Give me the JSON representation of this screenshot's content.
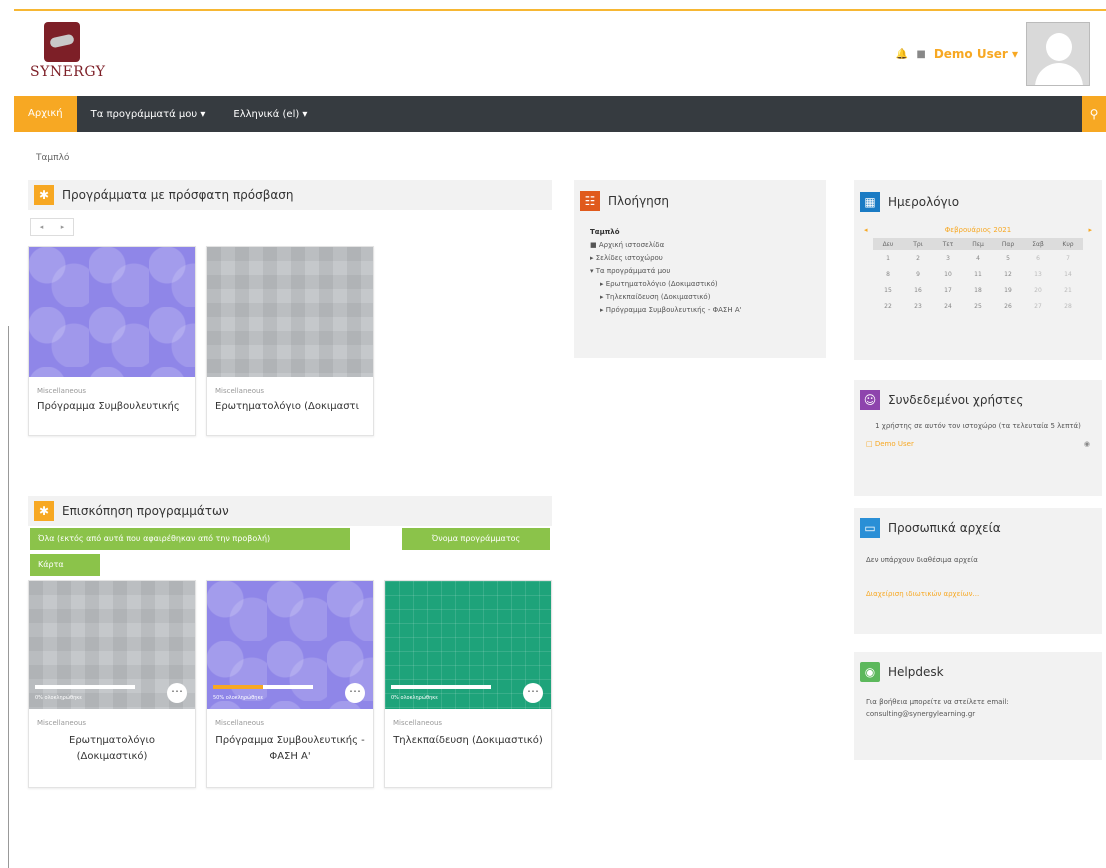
{
  "header": {
    "logo_text": "SYNERGY",
    "user_name": "Demo User",
    "user_caret": "▾",
    "bell_icon": "bell-icon",
    "messages_icon": "messages-icon"
  },
  "navbar": {
    "home": "Αρχική",
    "my_courses": "Τα προγράμματά μου ▾",
    "language": "Ελληνικά (el) ▾",
    "search_icon": "search-icon"
  },
  "breadcrumb": "Ταμπλό",
  "recent": {
    "title": "Προγράμματα με πρόσφατη πρόσβαση",
    "pager_prev": "◂",
    "pager_next": "▸",
    "cards": [
      {
        "category": "Miscellaneous",
        "title": "Πρόγραμμα Συμβουλευτικής",
        "image": "purple"
      },
      {
        "category": "Miscellaneous",
        "title": "Ερωτηματολόγιο (Δοκιμαστι",
        "image": "grey"
      }
    ]
  },
  "overview": {
    "title": "Επισκόπηση προγραμμάτων",
    "filter_button": "Όλα (εκτός από αυτά που αφαιρέθηκαν από την προβολή)",
    "sort_button": "Όνομα προγράμματος",
    "view_button": "Κάρτα",
    "cards": [
      {
        "category": "Miscellaneous",
        "title": "Ερωτηματολόγιο (Δοκιμαστικό)",
        "image": "grey",
        "progress": 0,
        "progress_label": "0% ολοκληρώθηκε"
      },
      {
        "category": "Miscellaneous",
        "title": "Πρόγραμμα Συμβουλευτικής - ΦΑΣΗ Α'",
        "image": "purple",
        "progress": 0.5,
        "progress_label": "50% ολοκληρώθηκε"
      },
      {
        "category": "Miscellaneous",
        "title": "Τηλεκπαίδευση (Δοκιμαστικό)",
        "image": "green",
        "progress": 0,
        "progress_label": "0% ολοκληρώθηκε"
      }
    ]
  },
  "navigation": {
    "title": "Πλοήγηση",
    "items": [
      "Ταμπλό",
      "Αρχική ιστοσελίδα",
      "Σελίδες ιστοχώρου",
      "Τα προγράμματά μου",
      "Ερωτηματολόγιο (Δοκιμαστικό)",
      "Τηλεκπαίδευση (Δοκιμαστικό)",
      "Πρόγραμμα Συμβουλευτικής - ΦΑΣΗ Α'"
    ]
  },
  "calendar": {
    "title": "Ημερολόγιο",
    "month": "Φεβρουάριος 2021",
    "prev": "◂",
    "next": "▸",
    "weekdays": [
      "Δευ",
      "Τρι",
      "Τετ",
      "Πεμ",
      "Παρ",
      "Σαβ",
      "Κυρ"
    ],
    "weeks": [
      [
        "1",
        "2",
        "3",
        "4",
        "5",
        "6",
        "7"
      ],
      [
        "8",
        "9",
        "10",
        "11",
        "12",
        "13",
        "14"
      ],
      [
        "15",
        "16",
        "17",
        "18",
        "19",
        "20",
        "21"
      ],
      [
        "22",
        "23",
        "24",
        "25",
        "26",
        "27",
        "28"
      ]
    ]
  },
  "online": {
    "title": "Συνδεδεμένοι χρήστες",
    "text": "1 χρήστης σε αυτόν τον ιστοχώρο (τα τελευταία 5 λεπτά)",
    "user": "Demo User"
  },
  "files": {
    "title": "Προσωπικά αρχεία",
    "text": "Δεν υπάρχουν διαθέσιμα αρχεία",
    "link": "Διαχείριση ιδιωτικών αρχείων..."
  },
  "helpdesk": {
    "title": "Helpdesk",
    "text": "Για βοήθεια μπορείτε να στείλετε email: consulting@synergylearning.gr"
  },
  "colors": {
    "accent": "#f7a823",
    "navbar": "#363b40",
    "green": "#8bc34a"
  }
}
